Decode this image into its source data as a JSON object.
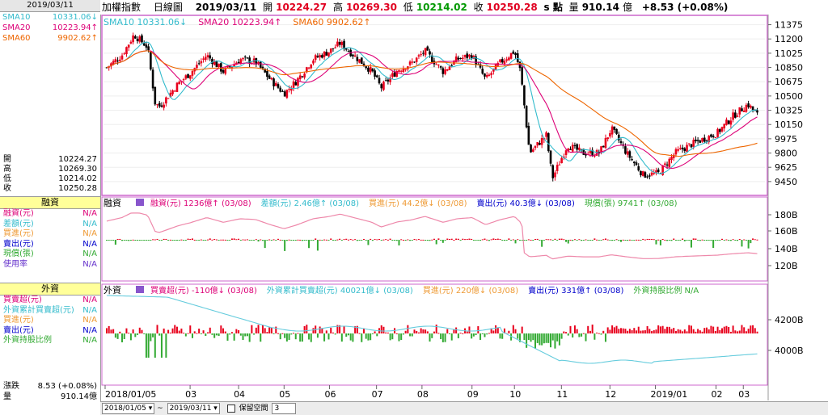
{
  "left_panel": {
    "date": "2019/03/11",
    "sma": [
      {
        "name": "SMA10",
        "value": "10331.06",
        "color": "#33bbcc",
        "arrow": "down"
      },
      {
        "name": "SMA20",
        "value": "10223.94",
        "color": "#dd0077",
        "arrow": "up"
      },
      {
        "name": "SMA60",
        "value": "9902.62",
        "color": "#ee6600",
        "arrow": "up"
      }
    ],
    "ohlc": [
      {
        "label": "開",
        "value": "10224.27"
      },
      {
        "label": "高",
        "value": "10269.30"
      },
      {
        "label": "低",
        "value": "10214.02"
      },
      {
        "label": "收",
        "value": "10250.28"
      }
    ],
    "margin_title": "融資",
    "margin_items": [
      {
        "label": "融資(元)",
        "value": "N/A",
        "color": "#dd0077"
      },
      {
        "label": "差額(元)",
        "value": "N/A",
        "color": "#33bbcc"
      },
      {
        "label": "買進(元)",
        "value": "N/A",
        "color": "#ee9933"
      },
      {
        "label": "賣出(元)",
        "value": "N/A",
        "color": "#0000cc"
      },
      {
        "label": "現償(張)",
        "value": "N/A",
        "color": "#33aa33"
      },
      {
        "label": "使用率",
        "value": "N/A",
        "color": "#6633cc"
      }
    ],
    "foreign_title": "外資",
    "foreign_items": [
      {
        "label": "買賣超(元)",
        "value": "N/A",
        "color": "#dd0077"
      },
      {
        "label": "外資累計買賣超(元)",
        "value": "N/A",
        "color": "#33bbcc"
      },
      {
        "label": "買進(元)",
        "value": "N/A",
        "color": "#ee9933"
      },
      {
        "label": "賣出(元)",
        "value": "N/A",
        "color": "#0000cc"
      },
      {
        "label": "外資持股比例",
        "value": "N/A",
        "color": "#33aa33"
      }
    ],
    "change_label": "漲跌",
    "change_value": "8.53 (+0.08%)",
    "volume_label": "量",
    "volume_value": "910.14億"
  },
  "header": {
    "index_name": "加權指數",
    "period": "日線圖",
    "date": "2019/03/11",
    "open_label": "開",
    "open": "10224.27",
    "high_label": "高",
    "high": "10269.30",
    "low_label": "低",
    "low": "10214.02",
    "close_label": "收",
    "close": "10250.28",
    "s_label": "s 點",
    "vol_label": "量",
    "volume": "910.14",
    "vol_unit": "億",
    "change": "+8.53 (+0.08%)"
  },
  "price_legend": {
    "sma10": "SMA10 10331.06",
    "sma20": "SMA20 10223.94",
    "sma60": "SMA60 9902.62"
  },
  "margin_legend": {
    "title": "融資",
    "items": [
      {
        "text": "融資(元) 1236億",
        "date": "(03/08)",
        "color": "#dd0077",
        "arrow": "up"
      },
      {
        "text": "差額(元) 2.46億",
        "date": "(03/08)",
        "color": "#33bbcc",
        "arrow": "up"
      },
      {
        "text": "買進(元) 44.2億",
        "date": "(03/08)",
        "color": "#ee9933",
        "arrow": "down"
      },
      {
        "text": "賣出(元) 40.3億",
        "date": "(03/08)",
        "color": "#0000cc",
        "arrow": "down"
      },
      {
        "text": "現償(張) 9741",
        "date": "(03/08)",
        "color": "#33aa33",
        "arrow": "up"
      }
    ]
  },
  "foreign_legend": {
    "title": "外資",
    "items": [
      {
        "text": "買賣超(元) -110億",
        "date": "(03/08)",
        "color": "#dd0077",
        "arrow": "down"
      },
      {
        "text": "外資累計買賣超(元) 40021億",
        "date": "(03/08)",
        "color": "#33bbcc",
        "arrow": "down"
      },
      {
        "text": "買進(元) 220億",
        "date": "(03/08)",
        "color": "#ee9933",
        "arrow": "down"
      },
      {
        "text": "賣出(元) 331億",
        "date": "(03/08)",
        "color": "#0000cc",
        "arrow": "up"
      },
      {
        "text": "外資持股比例 N/A",
        "date": "",
        "color": "#33aa33",
        "arrow": ""
      }
    ]
  },
  "status_bar": {
    "start_date": "2018/01/05",
    "end_date": "2019/03/11",
    "keep_space_label": "保留空間",
    "keep_space_value": "3"
  },
  "colors": {
    "up": "#e8001c",
    "down": "#008800",
    "sma10": "#33bbcc",
    "sma20": "#dd0077",
    "sma60": "#ee6600",
    "frame": "#cc66cc"
  },
  "chart_data": [
    {
      "type": "candlestick",
      "name": "price",
      "x_ticks": [
        "2018/01/05",
        "03",
        "04",
        "05",
        "06",
        "07",
        "08",
        "09",
        "10",
        "11",
        "12",
        "2019/01",
        "02",
        "03"
      ],
      "x_label_text": [
        "2018/01/05",
        "03",
        "04",
        "05",
        "06",
        "07",
        "08",
        "09",
        "10",
        "11",
        "12",
        "2019/01",
        "02",
        "03"
      ],
      "y_ticks": [
        "11375",
        "11200",
        "11025",
        "10850",
        "10675",
        "10500",
        "10325",
        "10150",
        "9975",
        "9800",
        "9625",
        "9450"
      ],
      "ylim": [
        9300,
        11460
      ],
      "close_series": [
        {
          "date": "2018-01-05",
          "close": 10850
        },
        {
          "date": "2018-01-15",
          "close": 11000
        },
        {
          "date": "2018-01-23",
          "close": 11253
        },
        {
          "date": "2018-02-01",
          "close": 11100
        },
        {
          "date": "2018-02-06",
          "close": 10404
        },
        {
          "date": "2018-02-09",
          "close": 10374
        },
        {
          "date": "2018-02-21",
          "close": 10650
        },
        {
          "date": "2018-03-01",
          "close": 10780
        },
        {
          "date": "2018-03-12",
          "close": 11000
        },
        {
          "date": "2018-03-23",
          "close": 10800
        },
        {
          "date": "2018-04-03",
          "close": 10950
        },
        {
          "date": "2018-04-13",
          "close": 10920
        },
        {
          "date": "2018-04-23",
          "close": 10700
        },
        {
          "date": "2018-05-02",
          "close": 10530
        },
        {
          "date": "2018-05-10",
          "close": 10680
        },
        {
          "date": "2018-05-21",
          "close": 10950
        },
        {
          "date": "2018-06-01",
          "close": 11050
        },
        {
          "date": "2018-06-08",
          "close": 11150
        },
        {
          "date": "2018-06-20",
          "close": 10950
        },
        {
          "date": "2018-06-29",
          "close": 10800
        },
        {
          "date": "2018-07-05",
          "close": 10600
        },
        {
          "date": "2018-07-16",
          "close": 10820
        },
        {
          "date": "2018-07-25",
          "close": 10900
        },
        {
          "date": "2018-08-03",
          "close": 11050
        },
        {
          "date": "2018-08-15",
          "close": 10800
        },
        {
          "date": "2018-08-24",
          "close": 10950
        },
        {
          "date": "2018-09-03",
          "close": 11000
        },
        {
          "date": "2018-09-12",
          "close": 10700
        },
        {
          "date": "2018-09-21",
          "close": 10900
        },
        {
          "date": "2018-10-01",
          "close": 11050
        },
        {
          "date": "2018-10-05",
          "close": 10800
        },
        {
          "date": "2018-10-11",
          "close": 9800
        },
        {
          "date": "2018-10-22",
          "close": 10020
        },
        {
          "date": "2018-10-26",
          "close": 9490
        },
        {
          "date": "2018-11-05",
          "close": 9900
        },
        {
          "date": "2018-11-15",
          "close": 9800
        },
        {
          "date": "2018-11-26",
          "close": 9800
        },
        {
          "date": "2018-12-04",
          "close": 10100
        },
        {
          "date": "2018-12-14",
          "close": 9800
        },
        {
          "date": "2018-12-25",
          "close": 9530
        },
        {
          "date": "2019-01-04",
          "close": 9550
        },
        {
          "date": "2019-01-15",
          "close": 9800
        },
        {
          "date": "2019-01-25",
          "close": 9900
        },
        {
          "date": "2019-02-12",
          "close": 10050
        },
        {
          "date": "2019-02-22",
          "close": 10250
        },
        {
          "date": "2019-03-04",
          "close": 10400
        },
        {
          "date": "2019-03-11",
          "close": 10250
        }
      ]
    },
    {
      "type": "bar+line",
      "name": "margin",
      "y_ticks": [
        "180B",
        "160B",
        "140B",
        "120B"
      ],
      "series": [
        {
          "name": "融資(元)",
          "description": "margin balance line, peaks ~180B mid-2018, falls toward ~120B after October"
        },
        {
          "name": "差額(元)",
          "description": "daily change bars, red positive / green negative"
        }
      ]
    },
    {
      "type": "bar+line",
      "name": "foreign",
      "y_ticks": [
        "4200B",
        "4000B"
      ],
      "series": [
        {
          "name": "買賣超(元)",
          "description": "daily net buy/sell bars, red buy / green sell"
        },
        {
          "name": "外資累計買賣超(元)",
          "description": "cumulative line, high early 2018, drops below 4000B, recovers to ~4021B"
        }
      ]
    }
  ]
}
